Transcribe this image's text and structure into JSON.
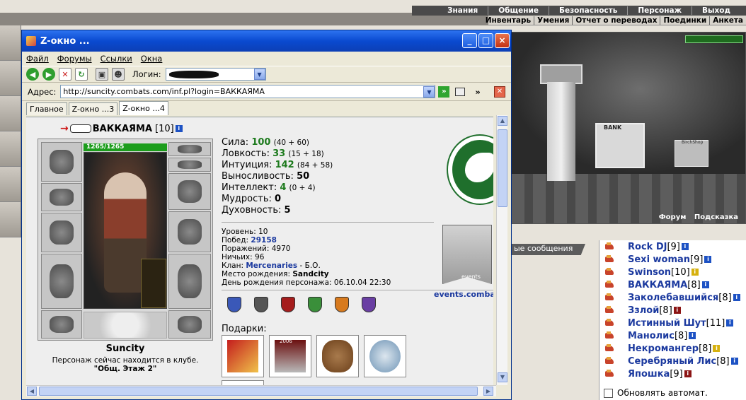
{
  "top_nav": [
    "Знания",
    "Общение",
    "Безопасность",
    "Персонаж",
    "Выход"
  ],
  "sub_nav": [
    "Инвентарь",
    "Умения",
    "Отчет о переводах",
    "Поединки",
    "Анкета"
  ],
  "scene": {
    "bank_sign": "BANK",
    "shop_sign": "BirchShop",
    "links": [
      "Форум",
      "Подсказка"
    ]
  },
  "strip_text": "ые сообщения",
  "window": {
    "title": "Z-окно ...",
    "menu": [
      "Файл",
      "Форумы",
      "Ссылки",
      "Окна"
    ],
    "login_label": "Логин:",
    "address_label": "Адрес:",
    "address": "http://suncity.combats.com/inf.pl?login=ВАККАЯМА",
    "more": "»",
    "tabs": [
      "Главное",
      "Z-окно ...3",
      "Z-окно ...4"
    ]
  },
  "character": {
    "name": "ВАККАЯМА",
    "level": "[10]",
    "hp": "1265/1265",
    "city": "Suncity",
    "location_text": "Персонаж сейчас находится в клубе.",
    "room": "\"Общ. Этаж 2\"",
    "stats": [
      {
        "label": "Сила:",
        "value": "100",
        "detail": "(40 + 60)"
      },
      {
        "label": "Ловкость:",
        "value": "33",
        "detail": "(15 + 18)"
      },
      {
        "label": "Интуиция:",
        "value": "142",
        "detail": "(84 + 58)"
      },
      {
        "label": "Выносливость:",
        "value": "50",
        "detail": ""
      },
      {
        "label": "Интеллект:",
        "value": "4",
        "detail": "(0 + 4)"
      },
      {
        "label": "Мудрость:",
        "value": "0",
        "detail": ""
      },
      {
        "label": "Духовность:",
        "value": "5",
        "detail": ""
      }
    ],
    "info": {
      "level": "Уровень: 10",
      "wins_label": "Побед:",
      "wins": "29158",
      "losses": "Поражений: 4970",
      "draws": "Ничьих: 96",
      "clan_label": "Клан:",
      "clan": "Mercenaries",
      "clan_suffix": "- Б.О.",
      "birthplace_label": "Место рождения:",
      "birthplace": "Sandcity",
      "birthday": "День рождения персонажа: 06.10.04 22:30"
    },
    "gifts_label": "Подарки:",
    "gift_year": "2006",
    "events_flag": "events",
    "events_link": "events.combats.com"
  },
  "users": [
    {
      "name": "Rock DJ",
      "level": "[9]",
      "mark": "i"
    },
    {
      "name": "Sexi woman",
      "level": "[9]",
      "mark": "i"
    },
    {
      "name": "Swinson",
      "level": "[10]",
      "mark": "y"
    },
    {
      "name": "ВАККАЯМА",
      "level": "[8]",
      "mark": "i"
    },
    {
      "name": "Заколебавшийся",
      "level": "[8]",
      "mark": "i"
    },
    {
      "name": "Ззлой",
      "level": "[8]",
      "mark": "r"
    },
    {
      "name": "Истинный Шут",
      "level": "[11]",
      "mark": "i"
    },
    {
      "name": "Манолис",
      "level": "[8]",
      "mark": "i"
    },
    {
      "name": "Некромангер",
      "level": "[8]",
      "mark": "y"
    },
    {
      "name": "Серебряный Лис",
      "level": "[8]",
      "mark": "i"
    },
    {
      "name": "Япошка",
      "level": "[9]",
      "mark": "r"
    }
  ],
  "auto_refresh": "Обновлять автомат.",
  "icon_info": "i"
}
